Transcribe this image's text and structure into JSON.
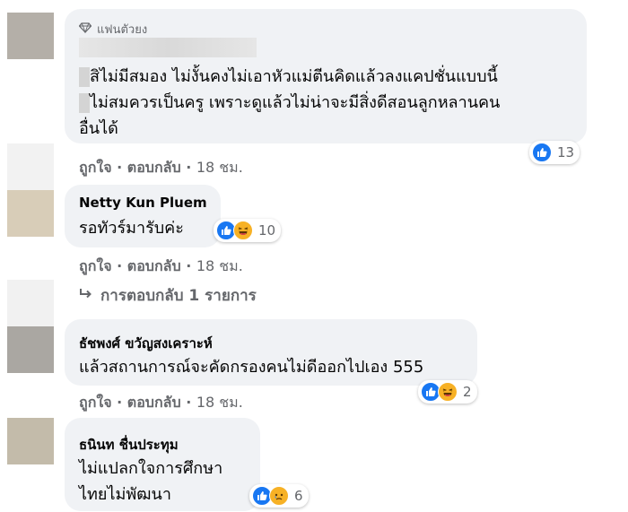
{
  "comments": [
    {
      "badge": "แฟนตัวยง",
      "lines": [
        "สิไม่มีสมอง ไม่งั้นคงไม่เอาหัวแม่ตีนคิดแล้วลงแคปชั่นแบบนี้",
        "ไม่สมควรเป็นครู เพราะดูแล้วไม่น่าจะมีสิ่งดีสอนลูกหลานคน",
        "อื่นได้"
      ],
      "like": "ถูกใจ",
      "reply": "ตอบกลับ",
      "time": "18 ชม.",
      "reaction_count": "13"
    },
    {
      "author": "Netty Kun Pluem",
      "lines": [
        "รอทัวร์มารับค่ะ"
      ],
      "like": "ถูกใจ",
      "reply": "ตอบกลับ",
      "time": "18 ชม.",
      "reaction_count": "10"
    },
    {
      "author": "ธัชพงศ์ ขวัญสงเคราะห์",
      "lines": [
        "แล้วสถานการณ์จะคัดกรองคนไม่ดีออกไปเอง 555"
      ],
      "like": "ถูกใจ",
      "reply": "ตอบกลับ",
      "time": "18 ชม.",
      "reaction_count": "2"
    },
    {
      "author": "ธนินท ชื่นประทุม",
      "lines": [
        "ไม่แปลกใจการศึกษา",
        "ไทยไม่พัฒนา"
      ],
      "reaction_count": "6"
    }
  ],
  "replies_link": "การตอบกลับ 1 รายการ",
  "separator": "·",
  "colors": {
    "bubble": "#f0f2f5",
    "meta": "#65676b",
    "like_blue": "#1877f2",
    "emoji_yellow": "#f7b125"
  },
  "icons": [
    "diamond-icon",
    "like-reaction-icon",
    "haha-reaction-icon",
    "sad-reaction-icon",
    "reply-arrow-icon"
  ]
}
